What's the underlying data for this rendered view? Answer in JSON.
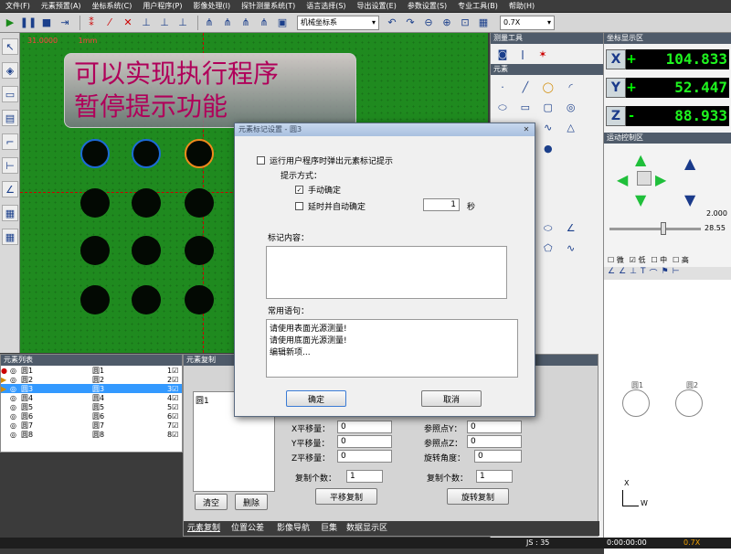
{
  "menu": [
    "文件(F)",
    "元素预置(A)",
    "坐标系统(C)",
    "用户程序(P)",
    "影像处理(I)",
    "探针测量系统(T)",
    "语言选择(S)",
    "导出设置(E)",
    "参数设置(S)",
    "专业工具(B)",
    "帮助(H)"
  ],
  "toolbar": {
    "coord_system": "机械坐标系",
    "zoom": "0.7X"
  },
  "camera": {
    "overlay_value": "31.0000",
    "overlay_unit": "1mm",
    "banner_line1": "可以实现执行程序",
    "banner_line2": "暂停提示功能"
  },
  "panels": {
    "measure_tools": "测量工具",
    "elements": "元素",
    "coord_display": "坐标显示区",
    "motion_control": "运动控制区",
    "speed_value": "2.000",
    "slider_value": "28.55",
    "speed_options": [
      "微",
      "低",
      "中",
      "高"
    ],
    "speed_checked": "低"
  },
  "coords": {
    "x": {
      "label": "X",
      "sign": "+",
      "value": "104.833"
    },
    "y": {
      "label": "Y",
      "sign": "+",
      "value": "52.447"
    },
    "z": {
      "label": "Z",
      "sign": "-",
      "value": "88.933"
    }
  },
  "element_list": {
    "title": "元素列表",
    "rows": [
      {
        "name": "圆1",
        "ref": "圆1",
        "num": "1"
      },
      {
        "name": "圆2",
        "ref": "圆2",
        "num": "2"
      },
      {
        "name": "圆3",
        "ref": "圆3",
        "num": "3"
      },
      {
        "name": "圆4",
        "ref": "圆4",
        "num": "4"
      },
      {
        "name": "圆5",
        "ref": "圆5",
        "num": "5"
      },
      {
        "name": "圆6",
        "ref": "圆6",
        "num": "6"
      },
      {
        "name": "圆7",
        "ref": "圆7",
        "num": "7"
      },
      {
        "name": "圆8",
        "ref": "圆8",
        "num": "8"
      }
    ]
  },
  "copy_panel": {
    "title": "元素复制",
    "list_item": "圆1",
    "x_shift": "X平移量：",
    "x_val": "0",
    "y_shift": "Y平移量：",
    "y_val": "0",
    "z_shift": "Z平移量：",
    "z_val": "0",
    "copy_count": "复制个数：",
    "copy_val": "1",
    "ref_y": "参照点Y：",
    "ref_y_val": "0",
    "ref_z": "参照点Z：",
    "ref_z_val": "0",
    "rot_angle": "旋转角度：",
    "rot_val": "0",
    "rot_count": "复制个数：",
    "rot_count_val": "1",
    "clear": "清空",
    "delete": "删除",
    "shift_copy": "平移复制",
    "rotate_copy": "旋转复制",
    "tabs": [
      "元素复制",
      "位置公差",
      "影像导航",
      "巨集",
      "数据显示区"
    ]
  },
  "graphics": {
    "labels": [
      "圆1",
      "圆2"
    ],
    "axis_x": "W",
    "axis_z": "X"
  },
  "dialog": {
    "title": "元素标记设置 - 圆3",
    "popup_option": "运行用户程序时弹出元素标记提示",
    "prompt_mode": "提示方式：",
    "manual_confirm": "手动确定",
    "auto_confirm": "延时并自动确定",
    "delay_value": "1",
    "delay_unit": "秒",
    "mark_content": "标记内容：",
    "common_phrases": "常用语句：",
    "phrases": [
      "请使用表面光源测量!",
      "请使用底面光源测量!",
      "编辑新项..."
    ],
    "ok": "确定",
    "cancel": "取消"
  },
  "status": {
    "js": "JS : 35",
    "time": "0:00:00:00",
    "zoom": "0.7X"
  }
}
